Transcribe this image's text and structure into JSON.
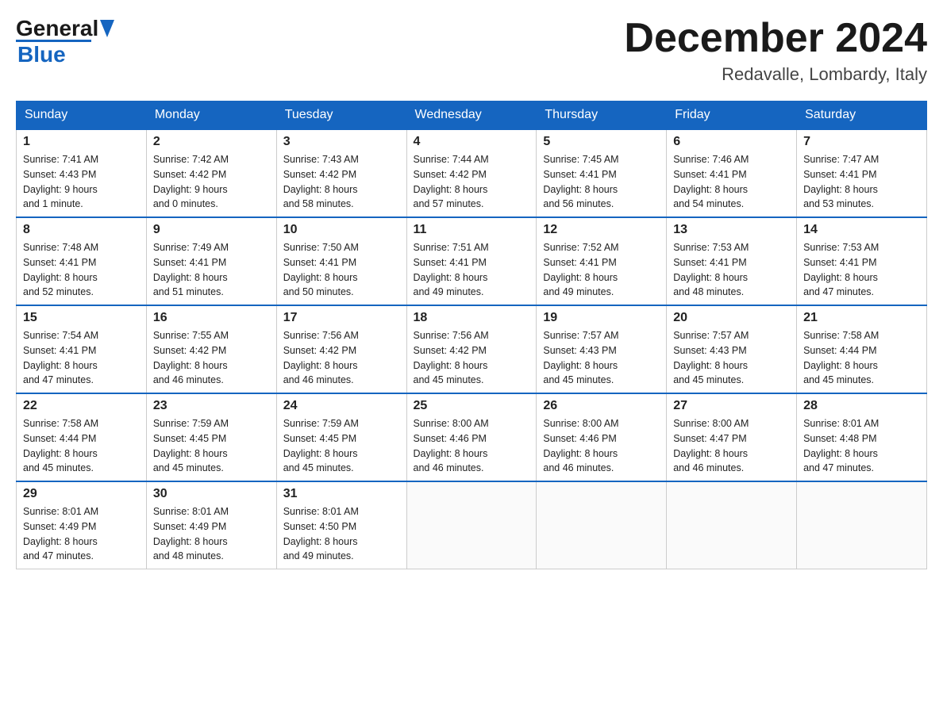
{
  "header": {
    "logo_line1": "General",
    "logo_line2": "Blue",
    "month": "December 2024",
    "location": "Redavalle, Lombardy, Italy"
  },
  "days_of_week": [
    "Sunday",
    "Monday",
    "Tuesday",
    "Wednesday",
    "Thursday",
    "Friday",
    "Saturday"
  ],
  "weeks": [
    [
      {
        "day": "1",
        "info": "Sunrise: 7:41 AM\nSunset: 4:43 PM\nDaylight: 9 hours\nand 1 minute."
      },
      {
        "day": "2",
        "info": "Sunrise: 7:42 AM\nSunset: 4:42 PM\nDaylight: 9 hours\nand 0 minutes."
      },
      {
        "day": "3",
        "info": "Sunrise: 7:43 AM\nSunset: 4:42 PM\nDaylight: 8 hours\nand 58 minutes."
      },
      {
        "day": "4",
        "info": "Sunrise: 7:44 AM\nSunset: 4:42 PM\nDaylight: 8 hours\nand 57 minutes."
      },
      {
        "day": "5",
        "info": "Sunrise: 7:45 AM\nSunset: 4:41 PM\nDaylight: 8 hours\nand 56 minutes."
      },
      {
        "day": "6",
        "info": "Sunrise: 7:46 AM\nSunset: 4:41 PM\nDaylight: 8 hours\nand 54 minutes."
      },
      {
        "day": "7",
        "info": "Sunrise: 7:47 AM\nSunset: 4:41 PM\nDaylight: 8 hours\nand 53 minutes."
      }
    ],
    [
      {
        "day": "8",
        "info": "Sunrise: 7:48 AM\nSunset: 4:41 PM\nDaylight: 8 hours\nand 52 minutes."
      },
      {
        "day": "9",
        "info": "Sunrise: 7:49 AM\nSunset: 4:41 PM\nDaylight: 8 hours\nand 51 minutes."
      },
      {
        "day": "10",
        "info": "Sunrise: 7:50 AM\nSunset: 4:41 PM\nDaylight: 8 hours\nand 50 minutes."
      },
      {
        "day": "11",
        "info": "Sunrise: 7:51 AM\nSunset: 4:41 PM\nDaylight: 8 hours\nand 49 minutes."
      },
      {
        "day": "12",
        "info": "Sunrise: 7:52 AM\nSunset: 4:41 PM\nDaylight: 8 hours\nand 49 minutes."
      },
      {
        "day": "13",
        "info": "Sunrise: 7:53 AM\nSunset: 4:41 PM\nDaylight: 8 hours\nand 48 minutes."
      },
      {
        "day": "14",
        "info": "Sunrise: 7:53 AM\nSunset: 4:41 PM\nDaylight: 8 hours\nand 47 minutes."
      }
    ],
    [
      {
        "day": "15",
        "info": "Sunrise: 7:54 AM\nSunset: 4:41 PM\nDaylight: 8 hours\nand 47 minutes."
      },
      {
        "day": "16",
        "info": "Sunrise: 7:55 AM\nSunset: 4:42 PM\nDaylight: 8 hours\nand 46 minutes."
      },
      {
        "day": "17",
        "info": "Sunrise: 7:56 AM\nSunset: 4:42 PM\nDaylight: 8 hours\nand 46 minutes."
      },
      {
        "day": "18",
        "info": "Sunrise: 7:56 AM\nSunset: 4:42 PM\nDaylight: 8 hours\nand 45 minutes."
      },
      {
        "day": "19",
        "info": "Sunrise: 7:57 AM\nSunset: 4:43 PM\nDaylight: 8 hours\nand 45 minutes."
      },
      {
        "day": "20",
        "info": "Sunrise: 7:57 AM\nSunset: 4:43 PM\nDaylight: 8 hours\nand 45 minutes."
      },
      {
        "day": "21",
        "info": "Sunrise: 7:58 AM\nSunset: 4:44 PM\nDaylight: 8 hours\nand 45 minutes."
      }
    ],
    [
      {
        "day": "22",
        "info": "Sunrise: 7:58 AM\nSunset: 4:44 PM\nDaylight: 8 hours\nand 45 minutes."
      },
      {
        "day": "23",
        "info": "Sunrise: 7:59 AM\nSunset: 4:45 PM\nDaylight: 8 hours\nand 45 minutes."
      },
      {
        "day": "24",
        "info": "Sunrise: 7:59 AM\nSunset: 4:45 PM\nDaylight: 8 hours\nand 45 minutes."
      },
      {
        "day": "25",
        "info": "Sunrise: 8:00 AM\nSunset: 4:46 PM\nDaylight: 8 hours\nand 46 minutes."
      },
      {
        "day": "26",
        "info": "Sunrise: 8:00 AM\nSunset: 4:46 PM\nDaylight: 8 hours\nand 46 minutes."
      },
      {
        "day": "27",
        "info": "Sunrise: 8:00 AM\nSunset: 4:47 PM\nDaylight: 8 hours\nand 46 minutes."
      },
      {
        "day": "28",
        "info": "Sunrise: 8:01 AM\nSunset: 4:48 PM\nDaylight: 8 hours\nand 47 minutes."
      }
    ],
    [
      {
        "day": "29",
        "info": "Sunrise: 8:01 AM\nSunset: 4:49 PM\nDaylight: 8 hours\nand 47 minutes."
      },
      {
        "day": "30",
        "info": "Sunrise: 8:01 AM\nSunset: 4:49 PM\nDaylight: 8 hours\nand 48 minutes."
      },
      {
        "day": "31",
        "info": "Sunrise: 8:01 AM\nSunset: 4:50 PM\nDaylight: 8 hours\nand 49 minutes."
      },
      null,
      null,
      null,
      null
    ]
  ]
}
